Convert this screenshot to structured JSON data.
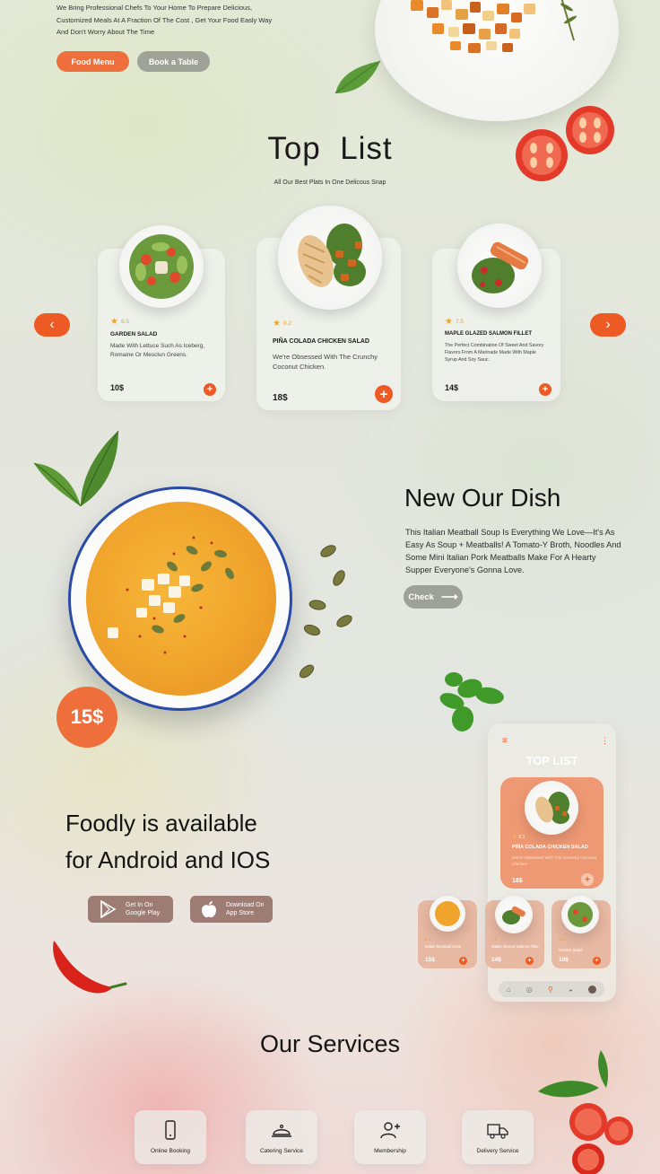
{
  "hero": {
    "tagline_lines": [
      "We Bring Professional Chefs To Your Home To Prepare Delicious,",
      "Customized Meals At A Fraction Of The Cost , Get Your Food Easly Way",
      "And Don't Worry About The Time"
    ],
    "food_menu_label": "Food Menu",
    "book_table_label": "Book a Table"
  },
  "top_list": {
    "title": "Top  List",
    "subtitle": "All Our Best Plats In One Delicous Snap",
    "prev_icon": "chevron-left-icon",
    "next_icon": "chevron-right-icon",
    "cards": [
      {
        "rating": "8.5",
        "name": "GARDEN SALAD",
        "desc": "Made With Lettuce Such As Iceberg, Romaine Or Mesclun Greens.",
        "price": "10$"
      },
      {
        "rating": "8.2",
        "name": "PIÑA COLADA CHICKEN SALAD",
        "desc": "We're Obsessed With The Crunchy Coconut Chicken.",
        "price": "18$"
      },
      {
        "rating": "7.5",
        "name": "MAPLE GLAZED SALMON FILLET",
        "desc": "The Perfect Combination Of Sweet And Savory Flavors From A Marinade Made With Maple Syrup And Soy Sauc.",
        "price": "14$"
      }
    ]
  },
  "new_dish": {
    "title": "New Our Dish",
    "description": "This Italian Meatball Soup Is Everything We Love—It's As Easy As Soup + Meatballs! A Tomato-Y Broth, Noodles And Some Mini Italian Pork Meatballs Make For A Hearty Supper Everyone's Gonna Love.",
    "check_label": "Check",
    "price": "15$"
  },
  "app": {
    "title_line1": "Foodly is available",
    "title_line2": "for Android and IOS",
    "google_play": {
      "line1": "Get In On",
      "line2": "Google Play"
    },
    "app_store": {
      "line1": "Download On",
      "line2": "App Store"
    },
    "phone": {
      "title": "TOP LIST",
      "featured": {
        "rating": "8.2",
        "name": "PIÑA COLADA CHICKEN SALAD",
        "desc": "We're Obsessed With The Crunchy Coconut Chicken",
        "price": "18$"
      },
      "minis": [
        {
          "rating": "8.1",
          "name": "Italian Meatball Soup",
          "price": "15$"
        },
        {
          "rating": "7.5",
          "name": "Maple Glazed Salmon Fillet",
          "price": "14$"
        },
        {
          "rating": "8.5",
          "name": "Garden Salad",
          "price": "10$"
        }
      ]
    }
  },
  "services": {
    "title": "Our Services",
    "items": [
      {
        "label": "Online Booking",
        "icon": "phone-icon"
      },
      {
        "label": "Catering Service",
        "icon": "cloche-icon"
      },
      {
        "label": "Membership",
        "icon": "user-add-icon"
      },
      {
        "label": "Delivery Service",
        "icon": "delivery-truck-icon"
      }
    ]
  },
  "colors": {
    "accent": "#ee5a24",
    "accent_soft": "#ee6f3c",
    "muted_button": "#9ea197",
    "store_button": "#9d7d73"
  }
}
